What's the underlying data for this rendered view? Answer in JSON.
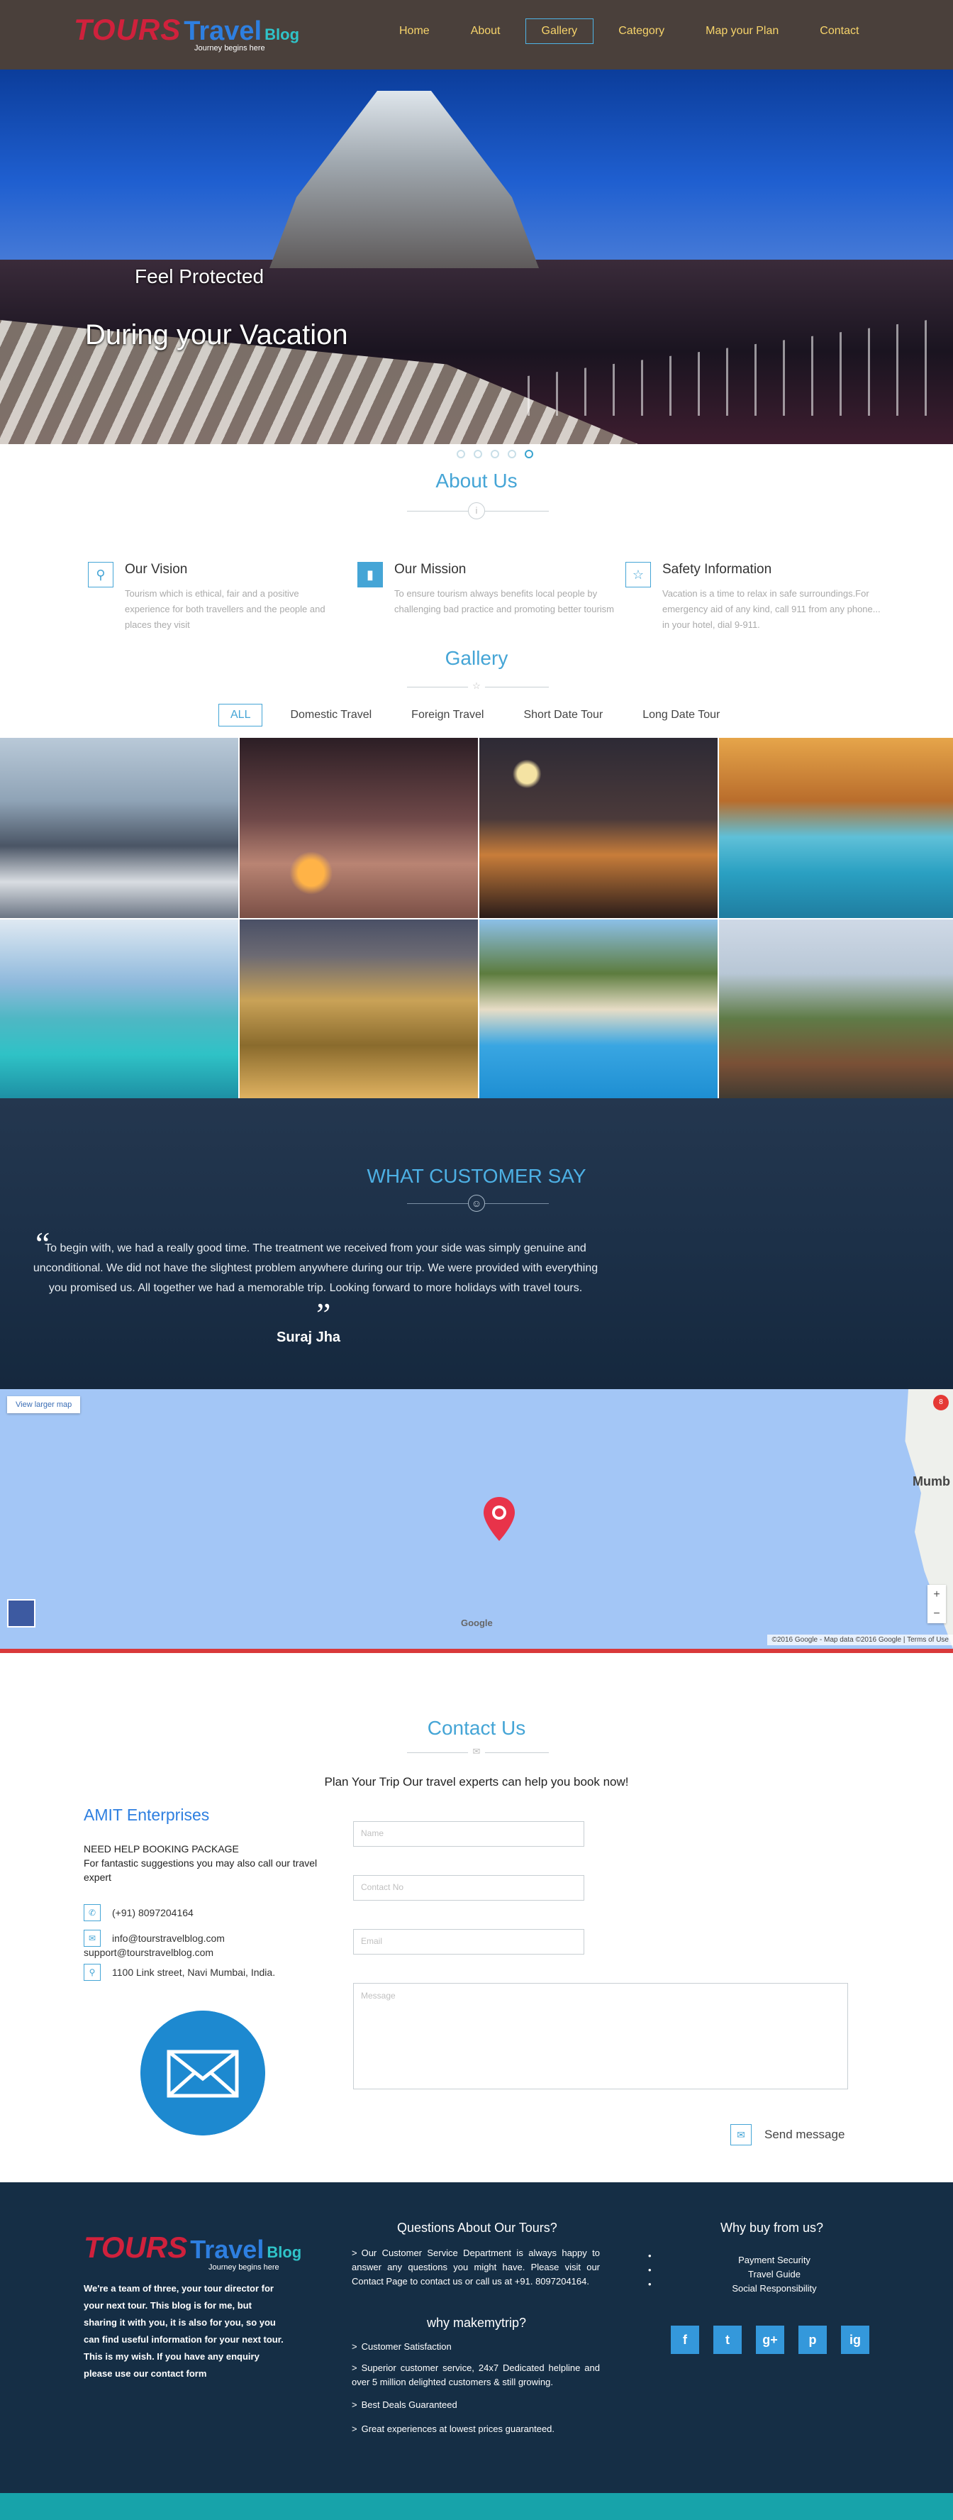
{
  "logo": {
    "part1": "TOURS",
    "part2": "Travel",
    "part3": "Blog",
    "tagline": "Journey begins here"
  },
  "nav": {
    "items": [
      "Home",
      "About",
      "Gallery",
      "Category",
      "Map your Plan",
      "Contact"
    ],
    "active": "Gallery"
  },
  "hero": {
    "caption1": "Feel Protected",
    "caption2": "During your Vacation",
    "slides": 5,
    "active_slide": 5
  },
  "about": {
    "title": "About Us",
    "features": [
      {
        "icon": "map-pin-icon",
        "title": "Our Vision",
        "text": "Tourism which is ethical, fair and a positive experience for both travellers and the people and places they visit"
      },
      {
        "icon": "book-icon",
        "title": "Our Mission",
        "text": "To ensure tourism always benefits local people by challenging bad practice and promoting better tourism"
      },
      {
        "icon": "star-icon",
        "title": "Safety Information",
        "text": "Vacation is a time to relax in safe surroundings.For emergency aid of any kind, call 911 from any phone... in your hotel, dial 9-911."
      }
    ]
  },
  "gallery": {
    "title": "Gallery",
    "tabs": [
      "ALL",
      "Domestic Travel",
      "Foreign Travel",
      "Short Date Tour",
      "Long Date Tour"
    ],
    "active_tab": "ALL",
    "images": [
      "snowy-town-photo",
      "desert-horse-photo",
      "night-city-photo",
      "pool-umbrella-photo",
      "lagoon-villas-photo",
      "palace-night-photo",
      "resort-pool-photo",
      "cliff-resort-photo"
    ]
  },
  "testimonial": {
    "title": "WHAT CUSTOMER SAY",
    "quote": "To begin with, we had a really good time. The treatment we received from your side was simply genuine and unconditional. We did not have the slightest problem anywhere during our trip. We were provided with everything you promised us. All together we had a memorable trip. Looking forward to more holidays with travel tours.",
    "author": "Suraj Jha"
  },
  "map": {
    "view_larger": "View larger map",
    "city": "Mumb",
    "marker_label": "8",
    "attribution": "©2016 Google - Map data ©2016 Google  |  Terms of Use",
    "brand": "Google"
  },
  "contact": {
    "title": "Contact Us",
    "subtitle": "Plan Your Trip Our travel experts can help you book now!",
    "company": "AMIT Enterprises",
    "need_title": "NEED HELP BOOKING PACKAGE",
    "need_text": "For fantastic suggestions you may also call our travel expert",
    "phone": "(+91) 8097204164",
    "email1": "info@tourstravelblog.com",
    "email2": "support@tourstravelblog.com",
    "address": "1100 Link street, Navi Mumbai, India.",
    "form": {
      "name_ph": "Name",
      "contact_ph": "Contact No",
      "email_ph": "Email",
      "message_ph": "Message",
      "send_label": "Send message"
    }
  },
  "footer": {
    "about": "We're a team of three, your tour director for your next tour. This blog is for me, but sharing it with you, it is also for you, so you can find useful information for your next tour. This is my wish. If you have any enquiry please use our contact form",
    "q_title": "Questions About Our Tours?",
    "q_text": "Our Customer Service Department is always happy to answer any questions you might have. Please visit our Contact Page to contact us or call us at +91. 8097204164.",
    "why_title": "why makemytrip?",
    "why_items": [
      "Customer Satisfaction",
      "Superior customer service, 24x7 Dedicated helpline and over 5 million delighted customers & still growing.",
      "Best Deals Guaranteed",
      "Great experiences at lowest prices guaranteed."
    ],
    "buy_title": "Why buy from us?",
    "buy_items": [
      "Payment Security",
      "Travel Guide",
      "Social Responsibility"
    ],
    "social": [
      "f",
      "t",
      "g+",
      "p",
      "ig"
    ]
  },
  "colors": {
    "accent": "#45a5d6",
    "nav_bg": "#4a403b",
    "nav_text": "#f7d46b",
    "footer_bg": "#152e45",
    "teal_bar": "#17a3aa"
  }
}
